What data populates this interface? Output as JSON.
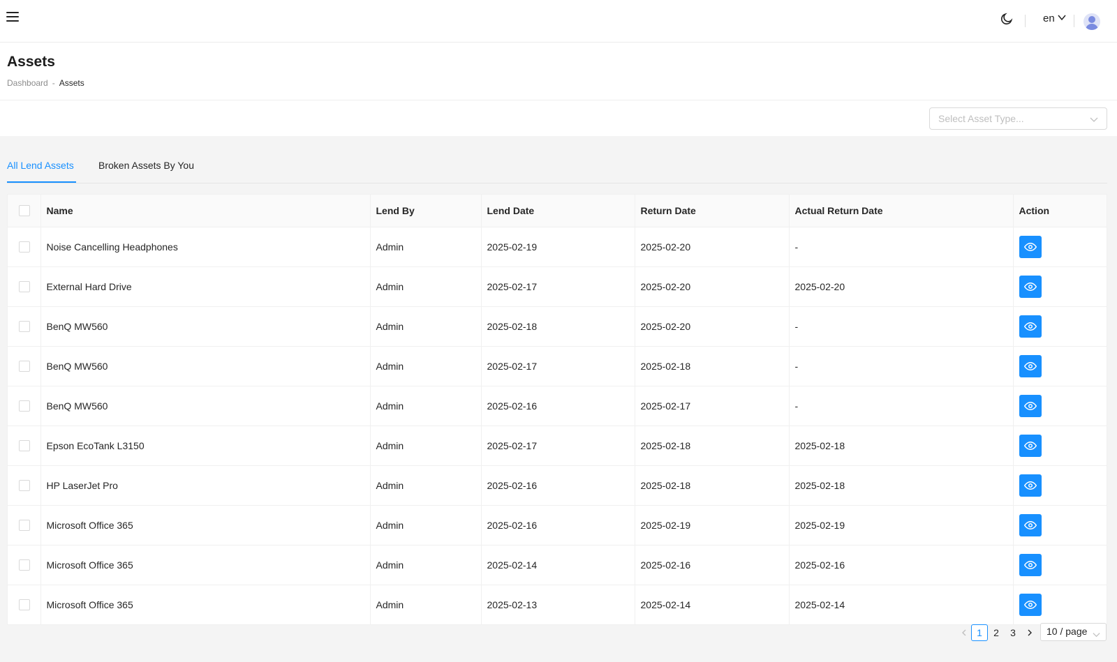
{
  "topbar": {
    "lang": "en"
  },
  "header": {
    "title": "Assets",
    "breadcrumb": {
      "parent": "Dashboard",
      "separator": "-",
      "current": "Assets"
    }
  },
  "filter": {
    "placeholder": "Select Asset Type..."
  },
  "tabs": [
    {
      "label": "All Lend Assets",
      "active": true
    },
    {
      "label": "Broken Assets By You",
      "active": false
    }
  ],
  "table": {
    "columns": [
      "Name",
      "Lend By",
      "Lend Date",
      "Return Date",
      "Actual Return Date",
      "Action"
    ],
    "rows": [
      {
        "name": "Noise Cancelling Headphones",
        "lend_by": "Admin",
        "lend_date": "2025-02-19",
        "return_date": "2025-02-20",
        "actual_return_date": "-"
      },
      {
        "name": "External Hard Drive",
        "lend_by": "Admin",
        "lend_date": "2025-02-17",
        "return_date": "2025-02-20",
        "actual_return_date": "2025-02-20"
      },
      {
        "name": "BenQ MW560",
        "lend_by": "Admin",
        "lend_date": "2025-02-18",
        "return_date": "2025-02-20",
        "actual_return_date": "-"
      },
      {
        "name": "BenQ MW560",
        "lend_by": "Admin",
        "lend_date": "2025-02-17",
        "return_date": "2025-02-18",
        "actual_return_date": "-"
      },
      {
        "name": "BenQ MW560",
        "lend_by": "Admin",
        "lend_date": "2025-02-16",
        "return_date": "2025-02-17",
        "actual_return_date": "-"
      },
      {
        "name": "Epson EcoTank L3150",
        "lend_by": "Admin",
        "lend_date": "2025-02-17",
        "return_date": "2025-02-18",
        "actual_return_date": "2025-02-18"
      },
      {
        "name": "HP LaserJet Pro",
        "lend_by": "Admin",
        "lend_date": "2025-02-16",
        "return_date": "2025-02-18",
        "actual_return_date": "2025-02-18"
      },
      {
        "name": "Microsoft Office 365",
        "lend_by": "Admin",
        "lend_date": "2025-02-16",
        "return_date": "2025-02-19",
        "actual_return_date": "2025-02-19"
      },
      {
        "name": "Microsoft Office 365",
        "lend_by": "Admin",
        "lend_date": "2025-02-14",
        "return_date": "2025-02-16",
        "actual_return_date": "2025-02-16"
      },
      {
        "name": "Microsoft Office 365",
        "lend_by": "Admin",
        "lend_date": "2025-02-13",
        "return_date": "2025-02-14",
        "actual_return_date": "2025-02-14"
      }
    ]
  },
  "pagination": {
    "pages": [
      "1",
      "2",
      "3"
    ],
    "current": "1",
    "page_size": "10 / page"
  },
  "colors": {
    "accent": "#1890ff"
  },
  "icons": {
    "menu": "hamburger-icon",
    "theme": "moon-icon",
    "lang_dropdown": "chevron-down-icon",
    "avatar": "user-avatar-icon",
    "view": "eye-icon",
    "prev": "chevron-left-icon",
    "next": "chevron-right-icon"
  }
}
